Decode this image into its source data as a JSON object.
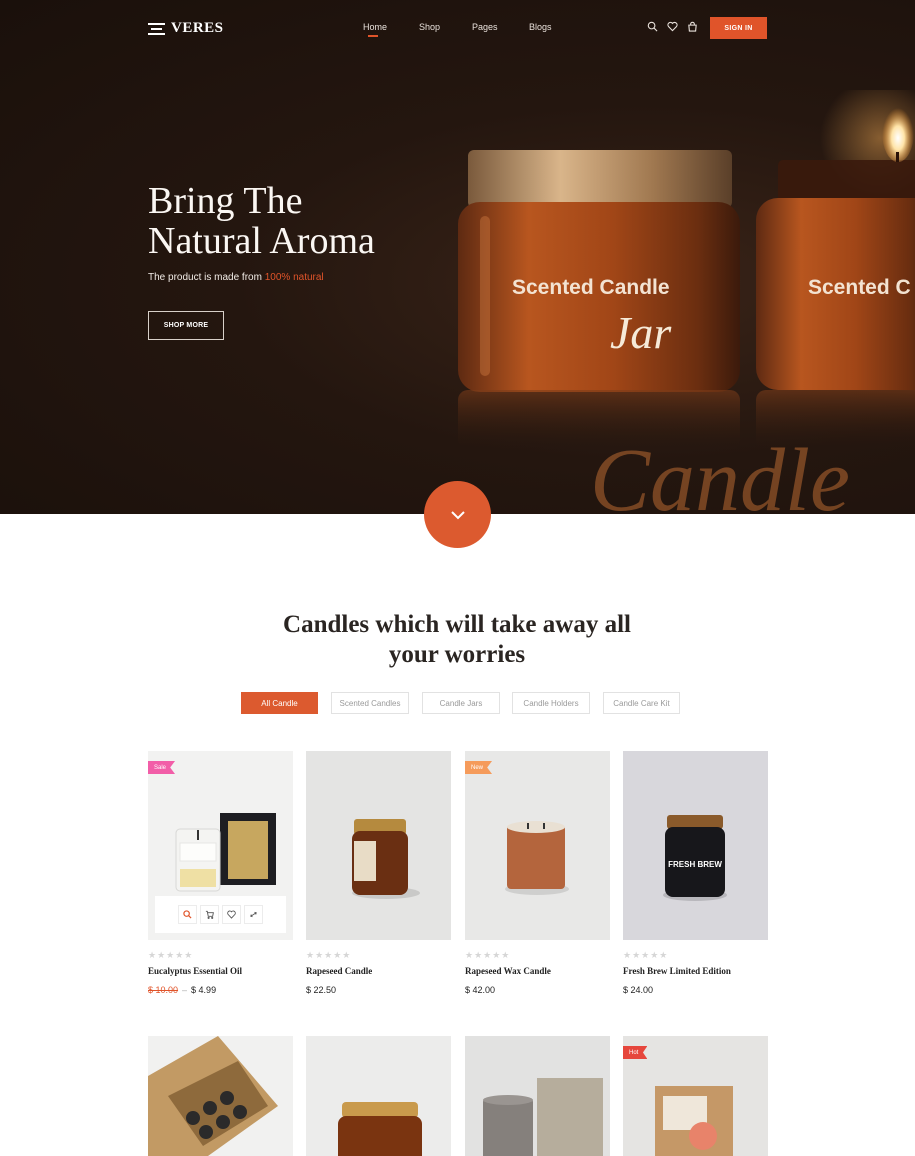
{
  "header": {
    "logo_text": "VERES",
    "nav": [
      {
        "label": "Home",
        "active": true
      },
      {
        "label": "Shop",
        "active": false
      },
      {
        "label": "Pages",
        "active": false
      },
      {
        "label": "Blogs",
        "active": false
      }
    ],
    "icons": [
      "search-icon",
      "heart-icon",
      "bag-icon"
    ],
    "signin_label": "SIGN IN"
  },
  "hero": {
    "title_line1": "Bring The",
    "title_line2": "Natural Aroma",
    "subtitle_prefix": "The product is made from ",
    "subtitle_accent": "100% natural",
    "cta_label": "SHOP MORE",
    "jar_label_1": "Scented Candle",
    "jar_label_2": "Scented C",
    "jar_script": "Jar",
    "reflection_text": "Candle"
  },
  "colors": {
    "accent": "#e0542a",
    "hero_bg": "#24160f",
    "sale_badge": "#f25ea8",
    "new_badge": "#f59b5b",
    "hot_badge": "#e6463c"
  },
  "section": {
    "title_line1": "Candles which will take away all",
    "title_line2": "your worries",
    "filters": [
      {
        "label": "All Candle",
        "active": true
      },
      {
        "label": "Scented Candles",
        "active": false
      },
      {
        "label": "Candle Jars",
        "active": false
      },
      {
        "label": "Candle Holders",
        "active": false
      },
      {
        "label": "Candle Care Kit",
        "active": false
      }
    ]
  },
  "products": [
    {
      "name": "Eucalyptus Essential Oil",
      "old_price": "$ 10.00",
      "price": "$ 4.99",
      "badge": "Sale",
      "rating": 0
    },
    {
      "name": "Rapeseed Candle",
      "price": "$ 22.50",
      "badge": "",
      "rating": 0
    },
    {
      "name": "Rapeseed Wax Candle",
      "price": "$ 42.00",
      "badge": "New",
      "rating": 0
    },
    {
      "name": "Fresh Brew Limited Edition",
      "price": "$ 24.00",
      "badge": "",
      "rating": 0,
      "jar_text": "FRESH BREW"
    },
    {
      "name": "",
      "price": "",
      "badge": "",
      "rating": 0
    },
    {
      "name": "",
      "price": "",
      "badge": "",
      "rating": 0
    },
    {
      "name": "",
      "price": "",
      "badge": "",
      "rating": 0
    },
    {
      "name": "",
      "price": "",
      "badge": "Hot",
      "rating": 0
    }
  ],
  "quick_actions": [
    "zoom-icon",
    "cart-icon",
    "heart-icon",
    "compare-icon"
  ],
  "stars_glyph": "★★★★★"
}
